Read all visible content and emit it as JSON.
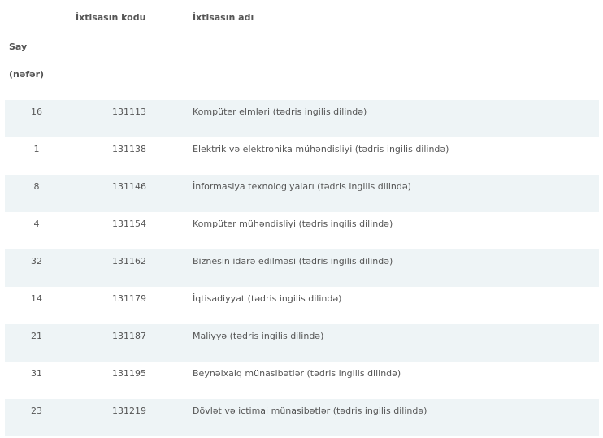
{
  "header": {
    "col_code": "İxtisasın kodu",
    "col_name": "İxtisasın adı",
    "col_count_line1": "Say",
    "col_count_line2": "(nəfər)"
  },
  "rows": [
    {
      "count": "16",
      "code": "131113",
      "name": "Kompüter elmləri (tədris ingilis dilində)"
    },
    {
      "count": "1",
      "code": "131138",
      "name": "Elektrik və elektronika mühəndisliyi (tədris ingilis dilində)"
    },
    {
      "count": "8",
      "code": "131146",
      "name": "İnformasiya texnologiyaları (tədris ingilis dilində)"
    },
    {
      "count": "4",
      "code": "131154",
      "name": "Kompüter mühəndisliyi (tədris ingilis dilində)"
    },
    {
      "count": "32",
      "code": "131162",
      "name": "Biznesin idarə edilməsi (tədris ingilis dilində)"
    },
    {
      "count": "14",
      "code": "131179",
      "name": "İqtisadiyyat (tədris ingilis dilində)"
    },
    {
      "count": "21",
      "code": "131187",
      "name": "Maliyyə (tədris ingilis dilində)"
    },
    {
      "count": "31",
      "code": "131195",
      "name": "Beynəlxalq münasibətlər (tədris ingilis dilində)"
    },
    {
      "count": "23",
      "code": "131219",
      "name": "Dövlət və ictimai münasibətlər (tədris ingilis dilində)"
    }
  ]
}
